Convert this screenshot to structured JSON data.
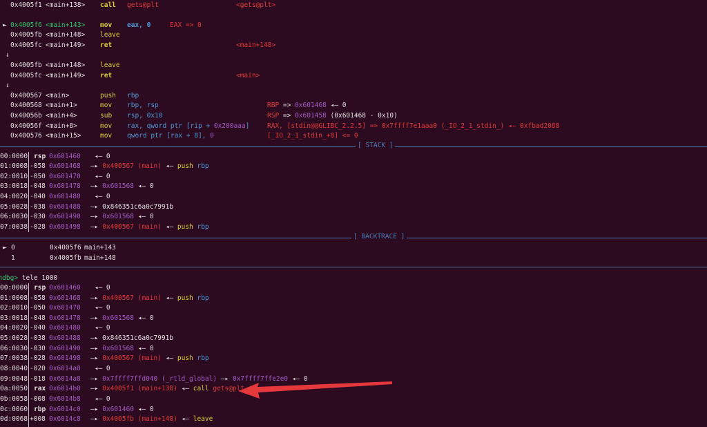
{
  "disasm": [
    {
      "addr": "0x4005f1",
      "sym": "<main+138>",
      "mn": "call",
      "ops": "gets@plt",
      "note": "<gets@plt>"
    },
    {
      "addr": "0x4005f6",
      "sym": "<main+143>",
      "mn": "mov",
      "ops": "eax, 0",
      "note": "EAX => 0",
      "current": true
    },
    {
      "addr": "0x4005fb",
      "sym": "<main+148>",
      "mn": "leave",
      "ops": "",
      "note": ""
    },
    {
      "addr": "0x4005fc",
      "sym": "<main+149>",
      "mn": "ret",
      "ops": "",
      "note": "<main+148>"
    },
    {
      "down_arrow": "↓"
    },
    {
      "addr": "0x4005fb",
      "sym": "<main+148>",
      "mn": "leave",
      "ops": "",
      "note": ""
    },
    {
      "addr": "0x4005fc",
      "sym": "<main+149>",
      "mn": "ret",
      "ops": "",
      "note": "<main>"
    },
    {
      "down_arrow": "↓"
    },
    {
      "addr": "0x400567",
      "sym": "<main>",
      "mn": "push",
      "ops": "rbp",
      "note": ""
    },
    {
      "addr": "0x400568",
      "sym": "<main+1>",
      "mn": "mov",
      "ops": "rbp, rsp",
      "note_reg": "RBP",
      "note_a": " => ",
      "note_v": "0x601468",
      "note_b": " ◂— 0"
    },
    {
      "addr": "0x40056b",
      "sym": "<main+4>",
      "mn": "sub",
      "ops": "rsp, 0x10",
      "note_reg": "RSP",
      "note_a": " => ",
      "note_v": "0x601458",
      "note_b": " (0x601468 - 0x10)"
    },
    {
      "addr": "0x40056f",
      "sym": "<main+8>",
      "mn": "mov",
      "ops_a": "rax, qword ptr [rip + ",
      "ops_b": "0x200aaa",
      "ops_c": "]",
      "note_full": "RAX, [stdin@@GLIBC_2.2.5] => 0x7ffff7e1aaa0 (_IO_2_1_stdin_) ◂— 0xfbad2088"
    },
    {
      "addr": "0x400576",
      "sym": "<main+15>",
      "mn": "mov",
      "ops_a": "qword ptr [rax + 8], ",
      "ops_b": "0",
      "note_full": "[_IO_2_1_stdin_+8] <= 0"
    }
  ],
  "sections": {
    "stack": "[ STACK ]",
    "backtrace": "[ BACKTRACE ]"
  },
  "stack1": [
    {
      "idx": "00:0000",
      "reg": "rsp",
      "off": "",
      "addr": "0x601460",
      "chain": "◂— 0"
    },
    {
      "idx": "01:0008",
      "reg": "",
      "off": "-058",
      "addr": "0x601468",
      "t1": "0x400567 (main)",
      "chain": "◂— push rbp"
    },
    {
      "idx": "02:0010",
      "reg": "",
      "off": "-050",
      "addr": "0x601470",
      "chain": "◂— 0"
    },
    {
      "idx": "03:0018",
      "reg": "",
      "off": "-048",
      "addr": "0x601478",
      "t1": "0x601568",
      "chain": "◂— 0"
    },
    {
      "idx": "04:0020",
      "reg": "",
      "off": "-040",
      "addr": "0x601480",
      "chain": "◂— 0"
    },
    {
      "idx": "05:0028",
      "reg": "",
      "off": "-038",
      "addr": "0x601488",
      "t1": "0x846351c6a0c7991b",
      "chain": ""
    },
    {
      "idx": "06:0030",
      "reg": "",
      "off": "-030",
      "addr": "0x601490",
      "t1": "0x601568",
      "chain": "◂— 0"
    },
    {
      "idx": "07:0038",
      "reg": "",
      "off": "-028",
      "addr": "0x601498",
      "t1": "0x400567 (main)",
      "chain": "◂— push rbp"
    }
  ],
  "backtrace": [
    {
      "n": "0",
      "addr": "0x4005f6",
      "sym": "main+143"
    },
    {
      "n": "1",
      "addr": "0x4005fb",
      "sym": "main+148"
    }
  ],
  "prompt": {
    "label": "pwndbg>",
    "cmd": " tele 1000"
  },
  "stack2": [
    {
      "idx": "00:0000",
      "reg": "rsp",
      "off": "",
      "addr": "0x601460",
      "chain": "◂— 0"
    },
    {
      "idx": "01:0008",
      "reg": "",
      "off": "-058",
      "addr": "0x601468",
      "t1": "0x400567 (main)",
      "chain": "◂— push rbp"
    },
    {
      "idx": "02:0010",
      "reg": "",
      "off": "-050",
      "addr": "0x601470",
      "chain": "◂— 0"
    },
    {
      "idx": "03:0018",
      "reg": "",
      "off": "-048",
      "addr": "0x601478",
      "t1": "0x601568",
      "chain": "◂— 0"
    },
    {
      "idx": "04:0020",
      "reg": "",
      "off": "-040",
      "addr": "0x601480",
      "chain": "◂— 0"
    },
    {
      "idx": "05:0028",
      "reg": "",
      "off": "-038",
      "addr": "0x601488",
      "t1": "0x846351c6a0c7991b",
      "chain": ""
    },
    {
      "idx": "06:0030",
      "reg": "",
      "off": "-030",
      "addr": "0x601490",
      "t1": "0x601568",
      "chain": "◂— 0"
    },
    {
      "idx": "07:0038",
      "reg": "",
      "off": "-028",
      "addr": "0x601498",
      "t1": "0x400567 (main)",
      "chain": "◂— push rbp"
    },
    {
      "idx": "08:0040",
      "reg": "",
      "off": "-020",
      "addr": "0x6014a0",
      "chain": "◂— 0"
    },
    {
      "idx": "09:0048",
      "reg": "",
      "off": "-018",
      "addr": "0x6014a8",
      "t1": "0x7ffff7ffd040 (_rtld_global)",
      "t2": "0x7ffff7ffe2e0",
      "chain": "◂— 0"
    },
    {
      "idx": "0a:0050",
      "reg": "rax",
      "off": "",
      "addr": "0x6014b0",
      "t1": "0x4005f1 (main+138)",
      "chain": "◂— call gets@plt"
    },
    {
      "idx": "0b:0058",
      "reg": "",
      "off": "-008",
      "addr": "0x6014b8",
      "chain": "◂— 0"
    },
    {
      "idx": "0c:0060",
      "reg": "rbp",
      "off": "",
      "addr": "0x6014c0",
      "t1": "0x601460",
      "chain": "◂— 0"
    },
    {
      "idx": "0d:0068",
      "reg": "",
      "off": "+008",
      "addr": "0x6014c8",
      "t1": "0x4005fb (main+148)",
      "chain": "◂— leave"
    }
  ],
  "colors": {
    "bg": "#2c0a1f",
    "annotation_arrow": "#e5383b"
  }
}
